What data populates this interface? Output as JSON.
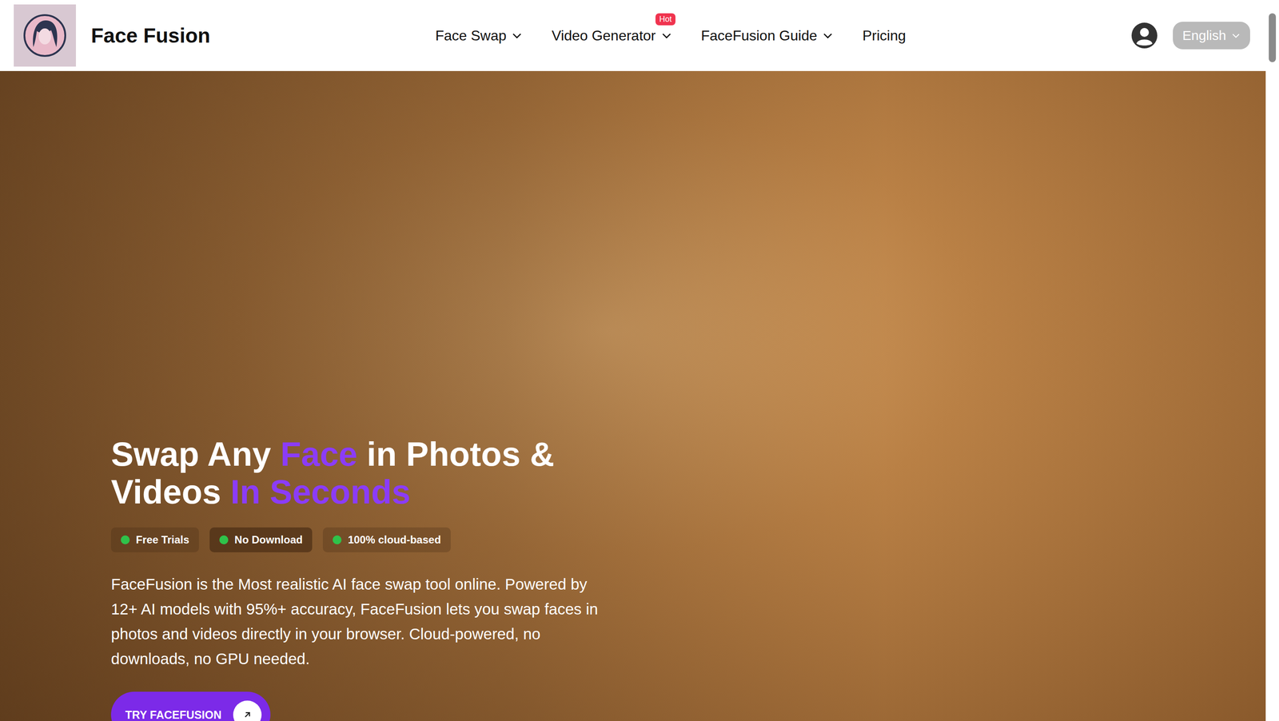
{
  "header": {
    "brand": "Face Fusion",
    "nav": [
      {
        "label": "Face Swap",
        "dropdown": true
      },
      {
        "label": "Video Generator",
        "dropdown": true,
        "badge": "Hot"
      },
      {
        "label": "FaceFusion Guide",
        "dropdown": true
      },
      {
        "label": "Pricing",
        "dropdown": false
      }
    ],
    "language": "English"
  },
  "hero": {
    "title": [
      [
        {
          "text": "Swap Any ",
          "highlight": false
        },
        {
          "text": "Face",
          "highlight": true
        },
        {
          "text": " in Photos &",
          "highlight": false
        }
      ],
      [
        {
          "text": "Videos ",
          "highlight": false
        },
        {
          "text": "In Seconds",
          "highlight": true
        }
      ]
    ],
    "badges": [
      {
        "label": "Free Trials",
        "highlighted": false
      },
      {
        "label": "No Download",
        "highlighted": true
      },
      {
        "label": "100% cloud-based",
        "highlighted": false
      }
    ],
    "description": "FaceFusion is the Most realistic AI face swap tool online. Powered by 12+ AI models with 95%+ accuracy, FaceFusion lets you swap faces in photos and videos directly in your browser. Cloud-powered, no downloads, no GPU needed.",
    "cta": "TRY FACEFUSION"
  }
}
